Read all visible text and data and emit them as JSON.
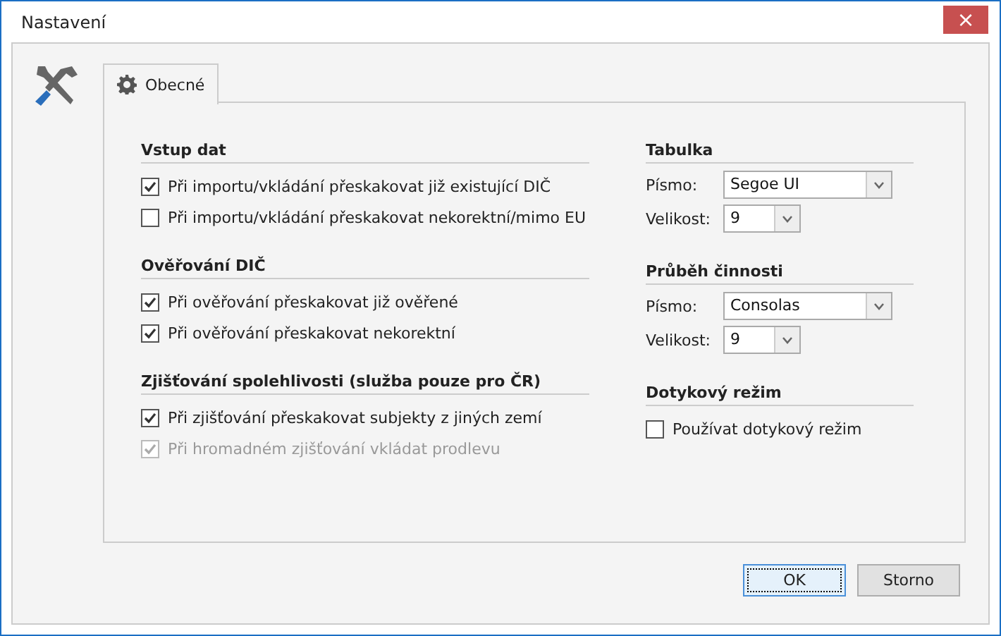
{
  "window": {
    "title": "Nastavení",
    "close": "×"
  },
  "tabs": [
    {
      "label": "Obecné",
      "selected": true
    }
  ],
  "left_sections": [
    {
      "title": "Vstup dat",
      "items": [
        {
          "label": "Při importu/vkládání přeskakovat již existující DIČ",
          "checked": true,
          "disabled": false
        },
        {
          "label": "Při importu/vkládání přeskakovat nekorektní/mimo EU",
          "checked": false,
          "disabled": false
        }
      ]
    },
    {
      "title": "Ověřování DIČ",
      "items": [
        {
          "label": "Při ověřování přeskakovat již ověřené",
          "checked": true,
          "disabled": false
        },
        {
          "label": "Při ověřování přeskakovat nekorektní",
          "checked": true,
          "disabled": false
        }
      ]
    },
    {
      "title": "Zjišťování spolehlivosti (služba pouze pro ČR)",
      "items": [
        {
          "label": "Při zjišťování přeskakovat subjekty z jiných zemí",
          "checked": true,
          "disabled": false
        },
        {
          "label": "Při hromadném zjišťování vkládat prodlevu",
          "checked": true,
          "disabled": true
        }
      ]
    }
  ],
  "right_sections": [
    {
      "title": "Tabulka",
      "fields": [
        {
          "kind": "wide",
          "label": "Písmo:",
          "value": "Segoe UI"
        },
        {
          "kind": "narrow",
          "label": "Velikost:",
          "value": "9"
        }
      ]
    },
    {
      "title": "Průběh činnosti",
      "fields": [
        {
          "kind": "wide",
          "label": "Písmo:",
          "value": "Consolas"
        },
        {
          "kind": "narrow",
          "label": "Velikost:",
          "value": "9"
        }
      ]
    },
    {
      "title": "Dotykový režim",
      "items": [
        {
          "label": "Používat dotykový režim",
          "checked": false,
          "disabled": false
        }
      ]
    }
  ],
  "buttons": [
    {
      "label": "OK",
      "focused": true
    },
    {
      "label": "Storno",
      "focused": false
    }
  ]
}
